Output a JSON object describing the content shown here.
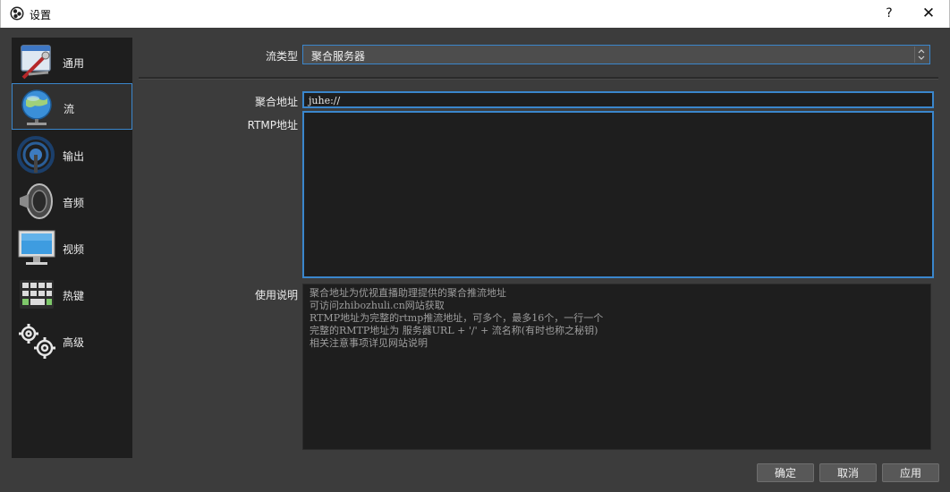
{
  "window": {
    "title": "设置",
    "help_label": "?",
    "close_label": "✕"
  },
  "sidebar": {
    "items": [
      {
        "label": "通用",
        "icon": "general-settings-icon"
      },
      {
        "label": "流",
        "icon": "globe-network-icon",
        "active": true
      },
      {
        "label": "输出",
        "icon": "broadcast-antenna-icon"
      },
      {
        "label": "音频",
        "icon": "speaker-icon"
      },
      {
        "label": "视频",
        "icon": "monitor-icon"
      },
      {
        "label": "热键",
        "icon": "keyboard-icon"
      },
      {
        "label": "高级",
        "icon": "gears-icon"
      }
    ]
  },
  "stream": {
    "type_label": "流类型",
    "type_value": "聚合服务器",
    "address_label": "聚合地址",
    "address_value": "juhe://",
    "rtmp_label": "RTMP地址",
    "rtmp_value": "",
    "help_label": "使用说明",
    "help_lines": [
      "聚合地址为优视直播助理提供的聚合推流地址",
      "可访问zhibozhuli.cn网站获取",
      "RTMP地址为完整的rtmp推流地址，可多个，最多16个，一行一个",
      "完整的RMTP地址为 服务器URL + '/' + 流名称(有时也称之秘钥)",
      "相关注意事项详见网站说明"
    ]
  },
  "buttons": {
    "ok": "确定",
    "cancel": "取消",
    "apply": "应用"
  },
  "colors": {
    "accent": "#3a86cc",
    "background": "#3c3c3c",
    "panel": "#1e1e1e"
  }
}
